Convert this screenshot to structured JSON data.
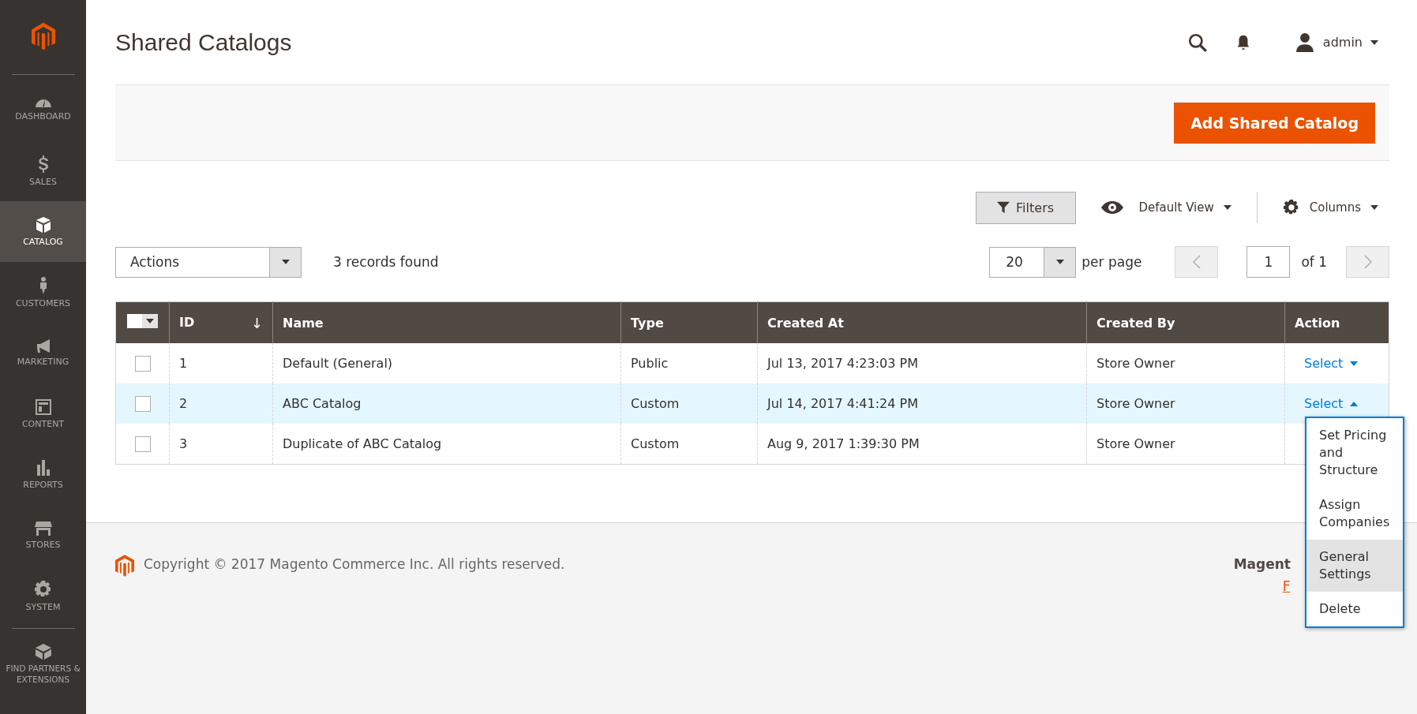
{
  "sidebar": {
    "items": [
      {
        "label": "DASHBOARD",
        "selected": false
      },
      {
        "label": "SALES",
        "selected": false
      },
      {
        "label": "CATALOG",
        "selected": true
      },
      {
        "label": "CUSTOMERS",
        "selected": false
      },
      {
        "label": "MARKETING",
        "selected": false
      },
      {
        "label": "CONTENT",
        "selected": false
      },
      {
        "label": "REPORTS",
        "selected": false
      },
      {
        "label": "STORES",
        "selected": false
      },
      {
        "label": "SYSTEM",
        "selected": false
      },
      {
        "label": "FIND PARTNERS & EXTENSIONS",
        "selected": false
      }
    ]
  },
  "page_title": "Shared Catalogs",
  "header": {
    "user": "admin"
  },
  "primary_button": "Add Shared Catalog",
  "toolbar": {
    "filters": "Filters",
    "view": "Default View",
    "columns": "Columns",
    "actions": "Actions",
    "records": "3 records found",
    "page_size": "20",
    "per_page": "per page",
    "page": "1",
    "of_pages": "of 1"
  },
  "table": {
    "columns": [
      {
        "label": "ID",
        "sorted": true
      },
      {
        "label": "Name",
        "sorted": false
      },
      {
        "label": "Type",
        "sorted": false
      },
      {
        "label": "Created At",
        "sorted": false
      },
      {
        "label": "Created By",
        "sorted": false
      },
      {
        "label": "Action",
        "sorted": false
      }
    ],
    "sort_arrow": "↓",
    "rows": [
      {
        "checked": false,
        "highlighted": false,
        "cells": [
          "1",
          "Default (General)",
          "Public",
          "Jul 13, 2017 4:23:03 PM",
          "Store Owner"
        ],
        "action": "Select",
        "expanded": false
      },
      {
        "checked": false,
        "highlighted": true,
        "cells": [
          "2",
          "ABC Catalog",
          "Custom",
          "Jul 14, 2017 4:41:24 PM",
          "Store Owner"
        ],
        "action": "Select",
        "expanded": true
      },
      {
        "checked": false,
        "highlighted": false,
        "cells": [
          "3",
          "Duplicate of ABC Catalog",
          "Custom",
          "Aug 9, 2017 1:39:30 PM",
          "Store Owner"
        ]
      }
    ]
  },
  "action_menu": [
    {
      "label": "Set Pricing and Structure",
      "selected": false
    },
    {
      "label": "Assign Companies",
      "selected": false
    },
    {
      "label": "General Settings",
      "selected": true
    },
    {
      "label": "Delete",
      "selected": false
    }
  ],
  "footer": {
    "copyright": "Copyright © 2017 Magento Commerce Inc. All rights reserved.",
    "right_title": "Magent",
    "right_link": "F"
  }
}
